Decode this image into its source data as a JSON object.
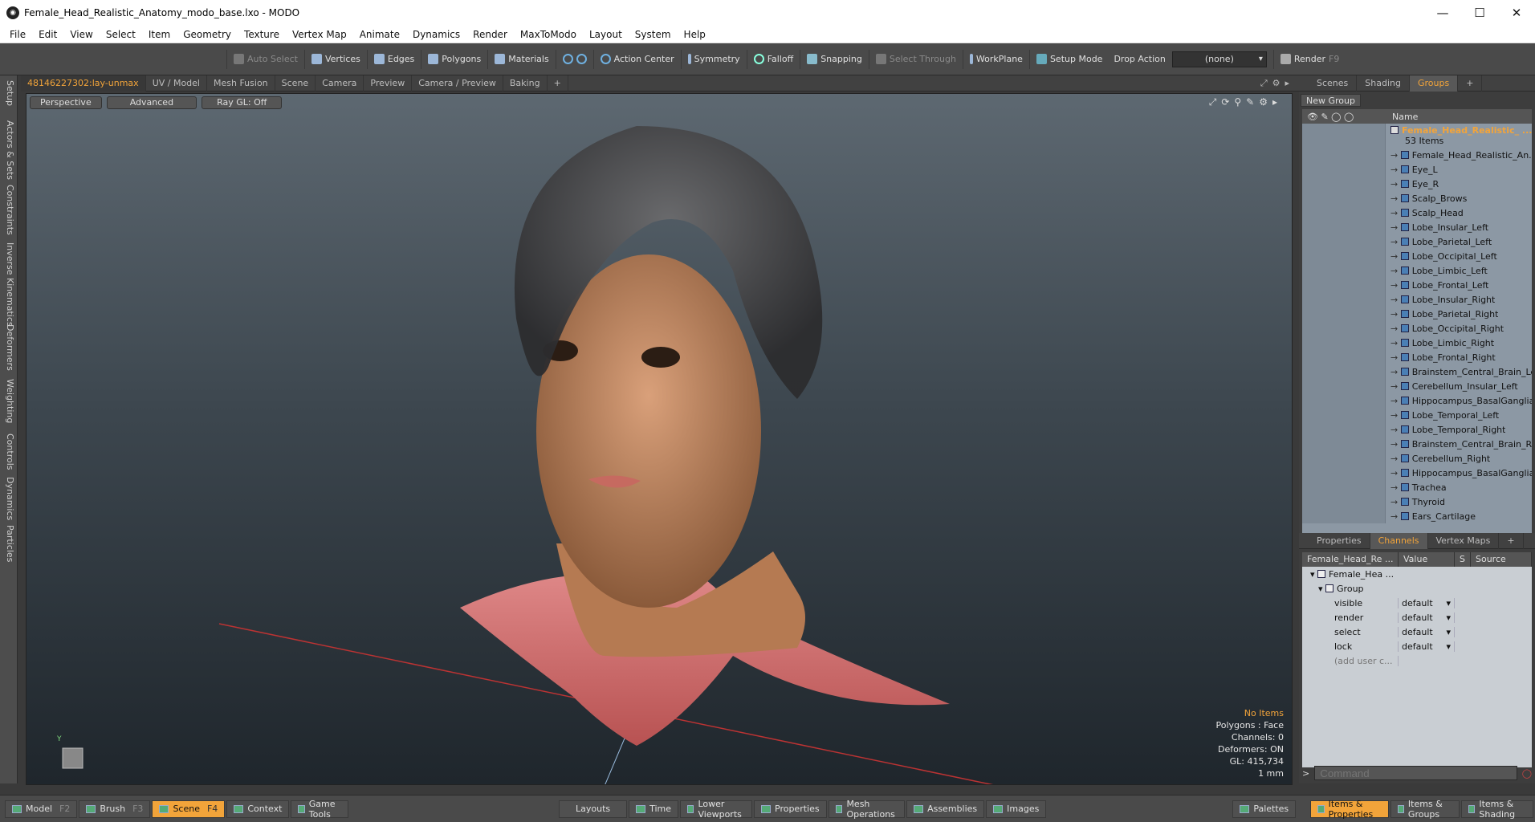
{
  "window": {
    "title": "Female_Head_Realistic_Anatomy_modo_base.lxo - MODO",
    "app_icon": "modo-logo-icon"
  },
  "menu": [
    "File",
    "Edit",
    "View",
    "Select",
    "Item",
    "Geometry",
    "Texture",
    "Vertex Map",
    "Animate",
    "Dynamics",
    "Render",
    "MaxToModo",
    "Layout",
    "System",
    "Help"
  ],
  "toolbar": {
    "auto_select": "Auto Select",
    "vertices": "Vertices",
    "edges": "Edges",
    "polygons": "Polygons",
    "materials": "Materials",
    "action_center": "Action Center",
    "symmetry": "Symmetry",
    "falloff": "Falloff",
    "snapping": "Snapping",
    "select_through": "Select Through",
    "workplane": "WorkPlane",
    "setup_mode": "Setup Mode",
    "drop_action": "Drop Action",
    "drop_value": "(none)",
    "render": "Render",
    "render_key": "F9"
  },
  "left_tabs": [
    "Setup",
    "Actors & Sets",
    "Constraints",
    "Inverse Kinematics",
    "Deformers",
    "Weighting",
    "Controls",
    "Dynamics",
    "Particles"
  ],
  "viewport_tabs": [
    "48146227302:lay-unmax",
    "UV / Model",
    "Mesh Fusion",
    "Scene",
    "Camera",
    "Preview",
    "Camera / Preview",
    "Baking",
    "+"
  ],
  "viewport": {
    "perspective": "Perspective",
    "advanced": "Advanced",
    "raygl": "Ray GL: Off"
  },
  "stats": {
    "items": "No Items",
    "polygons": "Polygons : Face",
    "channels": "Channels: 0",
    "deformers": "Deformers: ON",
    "gl": "GL: 415,734",
    "scale": "1 mm"
  },
  "right_tabs": [
    "Scenes",
    "Shading",
    "Groups",
    "+"
  ],
  "groups": {
    "new_group": "New Group",
    "name_header": "Name",
    "group_name": "Female_Head_Realistic_ ...",
    "count": "53 Items",
    "items": [
      "Female_Head_Realistic_An...",
      "Eye_L",
      "Eye_R",
      "Scalp_Brows",
      "Scalp_Head",
      "Lobe_Insular_Left",
      "Lobe_Parietal_Left",
      "Lobe_Occipital_Left",
      "Lobe_Limbic_Left",
      "Lobe_Frontal_Left",
      "Lobe_Insular_Right",
      "Lobe_Parietal_Right",
      "Lobe_Occipital_Right",
      "Lobe_Limbic_Right",
      "Lobe_Frontal_Right",
      "Brainstem_Central_Brain_Left",
      "Cerebellum_Insular_Left",
      "Hippocampus_BasalGanglia ...",
      "Lobe_Temporal_Left",
      "Lobe_Temporal_Right",
      "Brainstem_Central_Brain_R...",
      "Cerebellum_Right",
      "Hippocampus_BasalGanglia ...",
      "Trachea",
      "Thyroid",
      "Ears_Cartilage"
    ]
  },
  "channel_tabs": [
    "Properties",
    "Channels",
    "Vertex Maps",
    "+"
  ],
  "channels": {
    "col_name": "Female_Head_Re ...",
    "col_value": "Value",
    "col_s": "S",
    "col_source": "Source",
    "root": "Female_Hea ...",
    "group": "Group",
    "rows": [
      {
        "name": "visible",
        "value": "default"
      },
      {
        "name": "render",
        "value": "default"
      },
      {
        "name": "select",
        "value": "default"
      },
      {
        "name": "lock",
        "value": "default"
      }
    ],
    "add": "(add user c..."
  },
  "command": {
    "prompt": ">",
    "placeholder": "Command"
  },
  "bottom": {
    "model": "Model",
    "model_key": "F2",
    "brush": "Brush",
    "brush_key": "F3",
    "scene": "Scene",
    "scene_key": "F4",
    "context": "Context",
    "game_tools": "Game Tools",
    "layouts": "Layouts",
    "time": "Time",
    "lower_viewports": "Lower Viewports",
    "properties": "Properties",
    "mesh_operations": "Mesh Operations",
    "assemblies": "Assemblies",
    "images": "Images",
    "palettes": "Palettes",
    "items_properties": "Items & Properties",
    "items_groups": "Items & Groups",
    "items_shading": "Items & Shading"
  },
  "colors": {
    "accent": "#f2a43a",
    "list_bg": "#8c98a4"
  }
}
